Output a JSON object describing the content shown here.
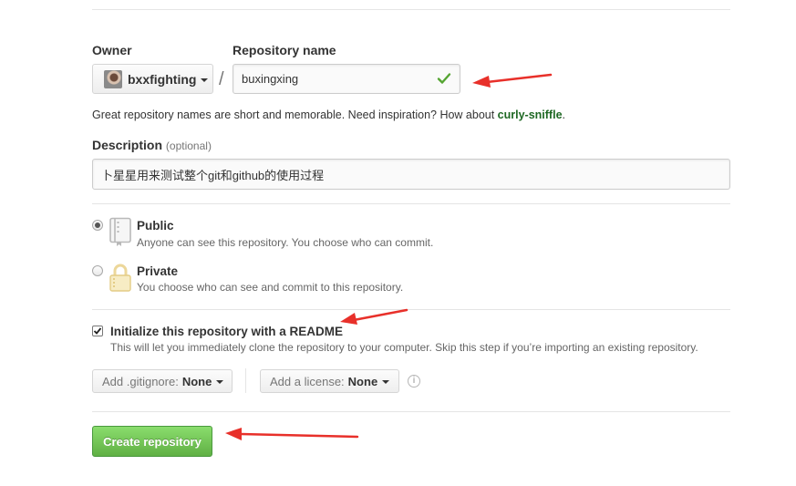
{
  "owner": {
    "label": "Owner",
    "value": "bxxfighting"
  },
  "separator": "/",
  "repository": {
    "label": "Repository name",
    "value": "buxingxing"
  },
  "hint": {
    "prefix": "Great repository names are short and memorable. Need inspiration? How about ",
    "suggestion": "curly-sniffle",
    "suffix": "."
  },
  "description": {
    "label": "Description",
    "optional": "(optional)",
    "value": "卜星星用来测试整个git和github的使用过程"
  },
  "visibility": {
    "public": {
      "title": "Public",
      "desc": "Anyone can see this repository. You choose who can commit.",
      "selected": true
    },
    "private": {
      "title": "Private",
      "desc": "You choose who can see and commit to this repository.",
      "selected": false
    }
  },
  "readme": {
    "label": "Initialize this repository with a README",
    "desc": "This will let you immediately clone the repository to your computer. Skip this step if you’re importing an existing repository.",
    "checked": true
  },
  "gitignore": {
    "label": "Add .gitignore:",
    "value": "None"
  },
  "license": {
    "label": "Add a license:",
    "value": "None"
  },
  "info_icon": "i",
  "create_button": "Create repository",
  "colors": {
    "accent_green": "#60b044",
    "suggestion_green": "#1e6823",
    "arrow_red": "#e8302a"
  }
}
